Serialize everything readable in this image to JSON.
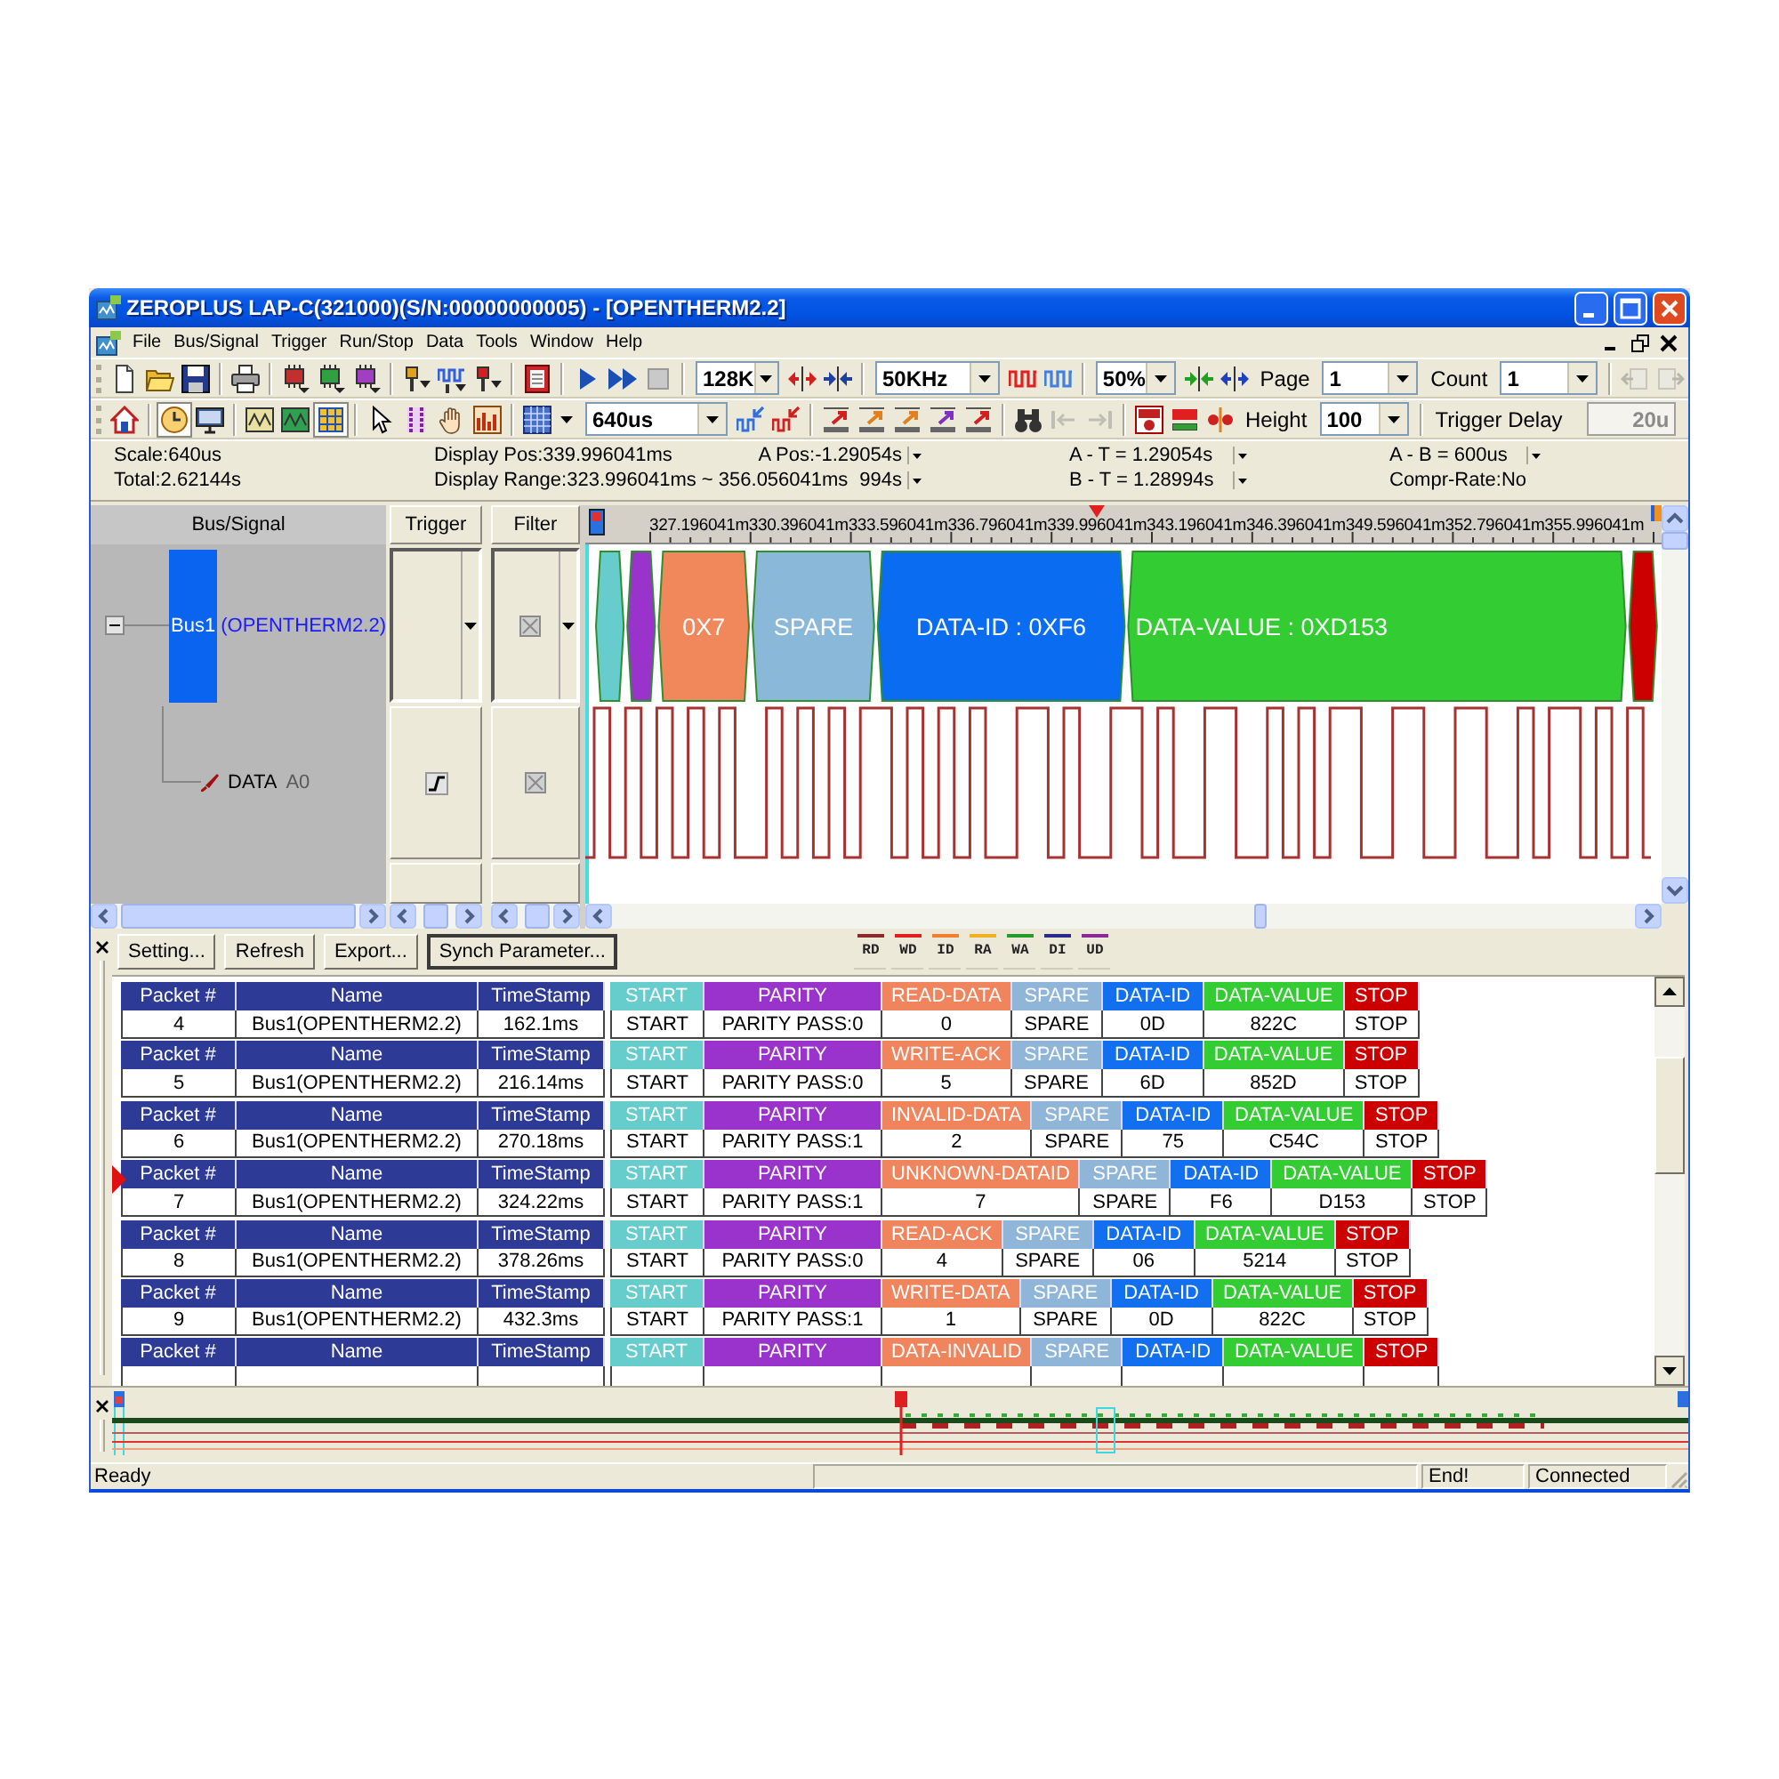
{
  "window": {
    "title": "ZEROPLUS LAP-C(321000)(S/N:00000000005) - [OPENTHERM2.2]"
  },
  "menu": [
    "File",
    "Bus/Signal",
    "Trigger",
    "Run/Stop",
    "Data",
    "Tools",
    "Window",
    "Help"
  ],
  "toolbar_1": [
    [
      {
        "kind": "button",
        "disabled": false
      },
      {
        "kind": "button",
        "disabled": false
      },
      {
        "kind": "button",
        "disabled": false
      }
    ],
    [
      {
        "kind": "button",
        "disabled": false
      }
    ],
    [
      {
        "kind": "button",
        "disabled": false
      },
      {
        "kind": "button",
        "disabled": false
      },
      {
        "kind": "button",
        "disabled": false
      }
    ],
    [
      {
        "kind": "button",
        "disabled": false
      },
      {
        "kind": "button",
        "disabled": false
      },
      {
        "kind": "button",
        "disabled": false
      }
    ],
    [
      {
        "kind": "button",
        "disabled": false
      }
    ],
    [
      {
        "kind": "button",
        "disabled": false
      },
      {
        "kind": "button",
        "disabled": false
      },
      {
        "kind": "button",
        "disabled": false
      }
    ],
    [
      {
        "kind": "combo",
        "value": "128K"
      },
      {
        "kind": "button",
        "disabled": false
      },
      {
        "kind": "button",
        "disabled": false
      }
    ],
    [
      {
        "kind": "combo",
        "value": "50KHz"
      },
      {
        "kind": "button",
        "disabled": false
      },
      {
        "kind": "button",
        "disabled": false
      }
    ],
    [
      {
        "kind": "combo",
        "value": "50%"
      },
      {
        "kind": "button",
        "disabled": false
      },
      {
        "kind": "button",
        "disabled": false
      },
      {
        "kind": "label",
        "text": "Page"
      },
      {
        "kind": "combo",
        "value": "1"
      },
      {
        "kind": "label",
        "text": "Count"
      },
      {
        "kind": "combo",
        "value": "1"
      }
    ],
    [
      {
        "kind": "button",
        "disabled": true
      },
      {
        "kind": "button",
        "disabled": true
      }
    ]
  ],
  "toolbar_2": [
    [
      {
        "kind": "button",
        "disabled": false,
        "on": false
      }
    ],
    [
      {
        "kind": "button",
        "disabled": false,
        "on": true
      },
      {
        "kind": "button",
        "disabled": false,
        "on": false
      }
    ],
    [
      {
        "kind": "button",
        "disabled": false,
        "on": false
      },
      {
        "kind": "button",
        "disabled": false,
        "on": false
      },
      {
        "kind": "button",
        "disabled": false,
        "on": true
      }
    ],
    [
      {
        "kind": "button",
        "disabled": false,
        "on": false
      },
      {
        "kind": "button",
        "disabled": false,
        "on": false
      },
      {
        "kind": "button",
        "disabled": false,
        "on": false
      },
      {
        "kind": "button",
        "disabled": false,
        "on": false
      }
    ],
    [
      {
        "kind": "splitbutton",
        "disabled": false,
        "on": false
      },
      {
        "kind": "combo",
        "value": "640us"
      },
      {
        "kind": "button",
        "disabled": false,
        "on": false
      },
      {
        "kind": "button",
        "disabled": false,
        "on": false
      }
    ],
    [
      {
        "kind": "button",
        "disabled": false,
        "on": false
      },
      {
        "kind": "button",
        "disabled": false,
        "on": false
      },
      {
        "kind": "button",
        "disabled": false,
        "on": false
      },
      {
        "kind": "button",
        "disabled": false,
        "on": false
      },
      {
        "kind": "button",
        "disabled": false,
        "on": false
      }
    ],
    [
      {
        "kind": "button",
        "disabled": false,
        "on": false
      },
      {
        "kind": "button",
        "disabled": true,
        "on": false
      },
      {
        "kind": "button",
        "disabled": true,
        "on": false
      }
    ],
    [
      {
        "kind": "button",
        "disabled": false,
        "on": false
      },
      {
        "kind": "button",
        "disabled": false,
        "on": false
      },
      {
        "kind": "button",
        "disabled": false,
        "on": false
      },
      {
        "kind": "label",
        "text": "Height"
      },
      {
        "kind": "combo",
        "value": "100"
      }
    ],
    [
      {
        "kind": "label",
        "text": "Trigger Delay"
      },
      {
        "kind": "field",
        "value": "20u",
        "disabled": true
      }
    ]
  ],
  "info": [
    {
      "lines": [
        {
          "text": "Scale:640us",
          "dropdown": false
        },
        {
          "text": "Total:2.62144s",
          "dropdown": false
        }
      ]
    },
    {
      "lines": [
        {
          "text": "Display Pos:339.996041ms",
          "dropdown": false
        },
        {
          "text": "Display Range:323.996041ms ~ 356.056041ms",
          "dropdown": false
        }
      ]
    },
    {
      "lines": [
        {
          "text": "A Pos:-1.29054s",
          "dropdown": true
        },
        {
          "text": "994s",
          "dropdown": true
        }
      ]
    },
    {
      "lines": [
        {
          "text": "A - T = 1.29054s",
          "dropdown": true
        },
        {
          "text": "B - T = 1.28994s",
          "dropdown": true
        }
      ]
    },
    {
      "lines": [
        {
          "text": "A - B = 600us",
          "dropdown": true
        },
        {
          "text": "Compr-Rate:No",
          "dropdown": false
        }
      ]
    }
  ],
  "signal_panel": {
    "columns": [
      "Bus/Signal",
      "Trigger",
      "Filter"
    ],
    "signals": [
      {
        "kind": "bus",
        "name": "Bus1",
        "protocol": "(OPENTHERM2.2)",
        "selected": true,
        "expanded": true,
        "children": [
          {
            "kind": "channel",
            "name": "DATA",
            "channel": "A0",
            "selected": false,
            "rising_edge": true
          }
        ]
      }
    ]
  },
  "waveform": {
    "ticks": [
      "327.196041m",
      "330.396041m",
      "333.596041m",
      "336.796041m",
      "339.996041m",
      "343.196041m",
      "346.396041m",
      "349.596041m",
      "352.796041m",
      "355.996041m"
    ],
    "segments": [
      {
        "kind": "start",
        "color": "#66cccc"
      },
      {
        "kind": "parity",
        "color": "#9933cc"
      },
      {
        "kind": "msg",
        "label": "0X7",
        "color": "#f0885c"
      },
      {
        "kind": "spare",
        "label": "SPARE",
        "color": "#8ab8d8"
      },
      {
        "kind": "id",
        "label": "DATA-ID : 0XF6",
        "color": "#0a6cf0"
      },
      {
        "kind": "value",
        "label": "DATA-VALUE : 0XD153",
        "color": "#33cc33"
      },
      {
        "kind": "stop",
        "color": "#cc0000"
      }
    ]
  },
  "packet_panel": {
    "buttons": [
      {
        "label": "Setting...",
        "default": false
      },
      {
        "label": "Refresh",
        "default": false
      },
      {
        "label": "Export...",
        "default": false
      },
      {
        "label": "Synch Parameter...",
        "default": true
      }
    ],
    "legend": [
      {
        "label": "RD",
        "color": "#8b2a2a"
      },
      {
        "label": "WD",
        "color": "#e02020"
      },
      {
        "label": "ID",
        "color": "#f08030"
      },
      {
        "label": "RA",
        "color": "#f0b020"
      },
      {
        "label": "WA",
        "color": "#2a9a2a"
      },
      {
        "label": "DI",
        "color": "#2a2a8a"
      },
      {
        "label": "UD",
        "color": "#8a2a9a"
      }
    ],
    "packets": [
      {
        "selected": false,
        "cells": [
          {
            "kind": "number",
            "header": "Packet #",
            "value": "4"
          },
          {
            "kind": "name",
            "header": "Name",
            "value": "Bus1(OPENTHERM2.2)"
          },
          {
            "kind": "time",
            "header": "TimeStamp",
            "value": "162.1ms"
          },
          {
            "kind": "start",
            "header": "START",
            "value": "START"
          },
          {
            "kind": "parity",
            "header": "PARITY",
            "value": "PARITY PASS:0"
          },
          {
            "kind": "msg",
            "header": "READ-DATA",
            "value": "0"
          },
          {
            "kind": "spare",
            "header": "SPARE",
            "value": "SPARE"
          },
          {
            "kind": "id",
            "header": "DATA-ID",
            "value": "0D"
          },
          {
            "kind": "value",
            "header": "DATA-VALUE",
            "value": "822C"
          },
          {
            "kind": "stop",
            "header": "STOP",
            "value": "STOP"
          }
        ]
      },
      {
        "selected": false,
        "cells": [
          {
            "kind": "number",
            "header": "Packet #",
            "value": "5"
          },
          {
            "kind": "name",
            "header": "Name",
            "value": "Bus1(OPENTHERM2.2)"
          },
          {
            "kind": "time",
            "header": "TimeStamp",
            "value": "216.14ms"
          },
          {
            "kind": "start",
            "header": "START",
            "value": "START"
          },
          {
            "kind": "parity",
            "header": "PARITY",
            "value": "PARITY PASS:0"
          },
          {
            "kind": "msg",
            "header": "WRITE-ACK",
            "value": "5"
          },
          {
            "kind": "spare",
            "header": "SPARE",
            "value": "SPARE"
          },
          {
            "kind": "id",
            "header": "DATA-ID",
            "value": "6D"
          },
          {
            "kind": "value",
            "header": "DATA-VALUE",
            "value": "852D"
          },
          {
            "kind": "stop",
            "header": "STOP",
            "value": "STOP"
          }
        ]
      },
      {
        "selected": false,
        "cells": [
          {
            "kind": "number",
            "header": "Packet #",
            "value": "6"
          },
          {
            "kind": "name",
            "header": "Name",
            "value": "Bus1(OPENTHERM2.2)"
          },
          {
            "kind": "time",
            "header": "TimeStamp",
            "value": "270.18ms"
          },
          {
            "kind": "start",
            "header": "START",
            "value": "START"
          },
          {
            "kind": "parity",
            "header": "PARITY",
            "value": "PARITY PASS:1"
          },
          {
            "kind": "msg",
            "header": "INVALID-DATA",
            "value": "2"
          },
          {
            "kind": "spare",
            "header": "SPARE",
            "value": "SPARE"
          },
          {
            "kind": "id",
            "header": "DATA-ID",
            "value": "75"
          },
          {
            "kind": "value",
            "header": "DATA-VALUE",
            "value": "C54C"
          },
          {
            "kind": "stop",
            "header": "STOP",
            "value": "STOP"
          }
        ]
      },
      {
        "selected": true,
        "cells": [
          {
            "kind": "number",
            "header": "Packet #",
            "value": "7"
          },
          {
            "kind": "name",
            "header": "Name",
            "value": "Bus1(OPENTHERM2.2)"
          },
          {
            "kind": "time",
            "header": "TimeStamp",
            "value": "324.22ms"
          },
          {
            "kind": "start",
            "header": "START",
            "value": "START"
          },
          {
            "kind": "parity",
            "header": "PARITY",
            "value": "PARITY PASS:1"
          },
          {
            "kind": "msg",
            "header": "UNKNOWN-DATAID",
            "value": "7"
          },
          {
            "kind": "spare",
            "header": "SPARE",
            "value": "SPARE"
          },
          {
            "kind": "id",
            "header": "DATA-ID",
            "value": "F6"
          },
          {
            "kind": "value",
            "header": "DATA-VALUE",
            "value": "D153"
          },
          {
            "kind": "stop",
            "header": "STOP",
            "value": "STOP"
          }
        ]
      },
      {
        "selected": false,
        "cells": [
          {
            "kind": "number",
            "header": "Packet #",
            "value": "8"
          },
          {
            "kind": "name",
            "header": "Name",
            "value": "Bus1(OPENTHERM2.2)"
          },
          {
            "kind": "time",
            "header": "TimeStamp",
            "value": "378.26ms"
          },
          {
            "kind": "start",
            "header": "START",
            "value": "START"
          },
          {
            "kind": "parity",
            "header": "PARITY",
            "value": "PARITY PASS:0"
          },
          {
            "kind": "msg",
            "header": "READ-ACK",
            "value": "4"
          },
          {
            "kind": "spare",
            "header": "SPARE",
            "value": "SPARE"
          },
          {
            "kind": "id",
            "header": "DATA-ID",
            "value": "06"
          },
          {
            "kind": "value",
            "header": "DATA-VALUE",
            "value": "5214"
          },
          {
            "kind": "stop",
            "header": "STOP",
            "value": "STOP"
          }
        ]
      },
      {
        "selected": false,
        "cells": [
          {
            "kind": "number",
            "header": "Packet #",
            "value": "9"
          },
          {
            "kind": "name",
            "header": "Name",
            "value": "Bus1(OPENTHERM2.2)"
          },
          {
            "kind": "time",
            "header": "TimeStamp",
            "value": "432.3ms"
          },
          {
            "kind": "start",
            "header": "START",
            "value": "START"
          },
          {
            "kind": "parity",
            "header": "PARITY",
            "value": "PARITY PASS:1"
          },
          {
            "kind": "msg",
            "header": "WRITE-DATA",
            "value": "1"
          },
          {
            "kind": "spare",
            "header": "SPARE",
            "value": "SPARE"
          },
          {
            "kind": "id",
            "header": "DATA-ID",
            "value": "0D"
          },
          {
            "kind": "value",
            "header": "DATA-VALUE",
            "value": "822C"
          },
          {
            "kind": "stop",
            "header": "STOP",
            "value": "STOP"
          }
        ]
      },
      {
        "selected": false,
        "cells": [
          {
            "kind": "number",
            "header": "Packet #"
          },
          {
            "kind": "name",
            "header": "Name"
          },
          {
            "kind": "time",
            "header": "TimeStamp"
          },
          {
            "kind": "start",
            "header": "START"
          },
          {
            "kind": "parity",
            "header": "PARITY"
          },
          {
            "kind": "msg",
            "header": "DATA-INVALID"
          },
          {
            "kind": "spare",
            "header": "SPARE"
          },
          {
            "kind": "id",
            "header": "DATA-ID"
          },
          {
            "kind": "value",
            "header": "DATA-VALUE"
          },
          {
            "kind": "stop",
            "header": "STOP"
          }
        ]
      }
    ]
  },
  "status_bar": {
    "message": "Ready",
    "panels": [
      "End!",
      "Connected"
    ]
  }
}
